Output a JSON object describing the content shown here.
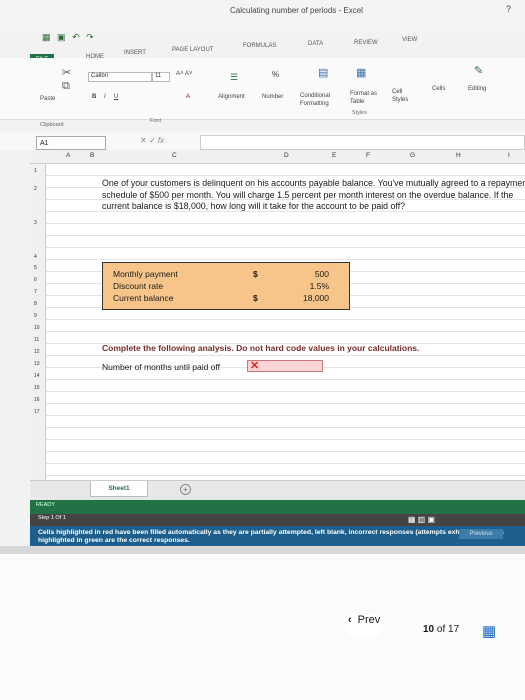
{
  "window": {
    "title": "Calculating number of periods - Excel",
    "help": "?"
  },
  "ribbon": {
    "file": "FILE",
    "tabs": [
      "HOME",
      "INSERT",
      "PAGE LAYOUT",
      "FORMULAS",
      "DATA",
      "REVIEW",
      "VIEW"
    ],
    "font_name": "Calibri",
    "font_size": "11",
    "paste": "Paste",
    "alignment": "Alignment",
    "number": "Number",
    "percent": "%",
    "conditional_formatting": "Conditional Formatting",
    "format_as_table": "Format as Table",
    "cell_styles": "Cell Styles",
    "cells": "Cells",
    "editing": "Editing",
    "groups": {
      "clipboard": "Clipboard",
      "font": "Font",
      "styles": "Styles"
    }
  },
  "formula_bar": {
    "name_box": "A1",
    "fx": "fx"
  },
  "grid": {
    "columns": [
      "A",
      "B",
      "C",
      "D",
      "E",
      "F",
      "G",
      "H",
      "I"
    ],
    "rows": [
      "1",
      "2",
      "3",
      "4",
      "5",
      "6",
      "7",
      "8",
      "9",
      "10",
      "11",
      "12",
      "13",
      "14",
      "15",
      "16",
      "17"
    ]
  },
  "problem": {
    "text": "One of your customers is delinquent on his accounts payable balance. You've mutually agreed to a repayment schedule of $500 per month. You will charge 1.5 percent per month interest on the overdue balance. If the current balance is $18,000, how long will it take for the account to be paid off?"
  },
  "inputs": [
    {
      "label": "Monthly payment",
      "currency": "$",
      "value": "500"
    },
    {
      "label": "Discount rate",
      "currency": "",
      "value": "1.5%"
    },
    {
      "label": "Current balance",
      "currency": "$",
      "value": "18,000"
    }
  ],
  "instruction": "Complete the following analysis. Do not hard code values in your calculations.",
  "answer": {
    "label": "Number of months until paid off",
    "mark": "✕"
  },
  "sheet": {
    "tab": "Sheet1",
    "add": "+"
  },
  "status": {
    "ready": "READY",
    "step": "Step 1 Of 1"
  },
  "feedback": {
    "text": "Cells highlighted in red have been filled automatically as they are partially attempted, left blank, incorrect responses (attempts exhausted). Cells highlighted in green are the correct responses.",
    "previous": "Previous"
  },
  "pagination": {
    "prev": "Prev",
    "current": "10",
    "of": "of",
    "total": "17"
  },
  "colors": {
    "excel_green": "#217346",
    "input_fill": "#f7c58a",
    "answer_fill": "#fbd5d5",
    "feedback_blue": "#1d5f8c"
  }
}
